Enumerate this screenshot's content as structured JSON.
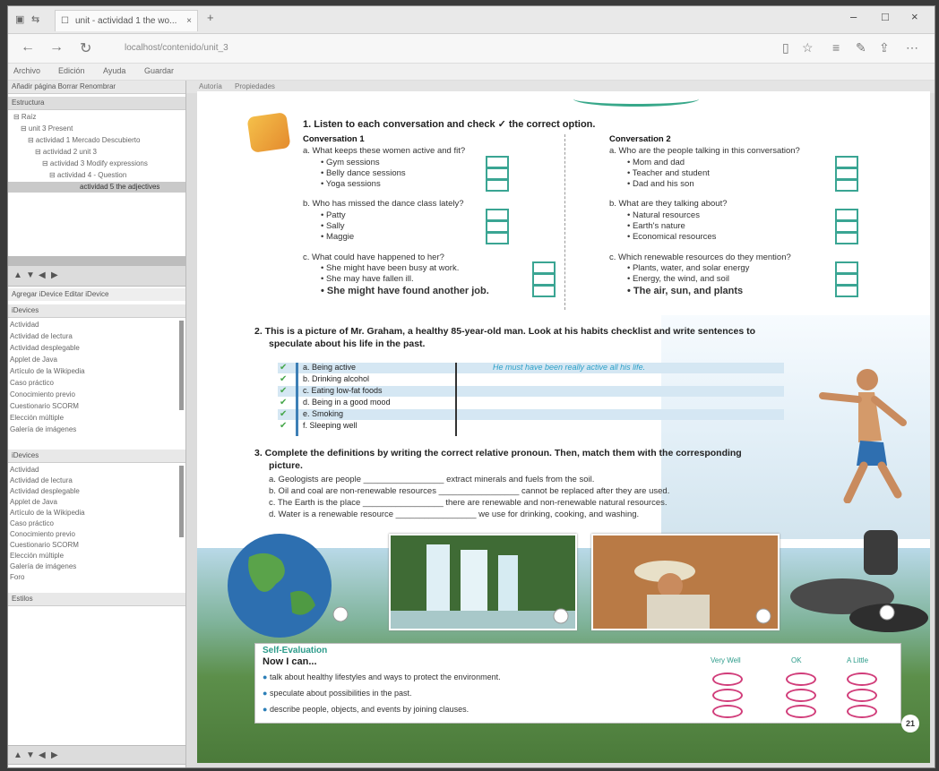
{
  "browser": {
    "tab_title": "unit - actividad 1 the wo...",
    "tab_close": "×",
    "new_tab": "+",
    "url": "localhost/contenido/unit_3",
    "menu_items": [
      "Archivo",
      "Edición",
      "Ayuda",
      "Guardar"
    ],
    "win_min": "–",
    "win_max": "□",
    "win_close": "×"
  },
  "leftpanel": {
    "top_buttons": "Añadir página   Borrar   Renombrar",
    "section1_title": "Estructura",
    "tree": [
      "⊟ Raíz",
      "⊟ unit 3 Present",
      "⊟ actividad 1 Mercado Descubierto",
      "⊟ actividad 2 unit 3",
      "⊟ actividad 3 Modify expressions",
      "⊟ actividad 4 - Question",
      "actividad 5 the adjectives"
    ],
    "mid_buttons": "Agregar iDevice   Editar iDevice",
    "section2_title": "iDevices",
    "list1": [
      "Actividad",
      "Actividad de lectura",
      "Actividad desplegable",
      "Applet de Java",
      "Artículo de la Wikipedia",
      "Caso práctico",
      "Conocimiento previo",
      "Cuestionario SCORM",
      "Elección múltiple",
      "Galería de imágenes"
    ],
    "section3_title": "iDevices",
    "list2": [
      "Actividad",
      "Actividad de lectura",
      "Actividad desplegable",
      "Applet de Java",
      "Artículo de la Wikipedia",
      "Caso práctico",
      "Conocimiento previo",
      "Cuestionario SCORM",
      "Elección múltiple",
      "Galería de imágenes",
      "Foro"
    ],
    "section4_title": "Estilos"
  },
  "doc": {
    "tab1": "Autoría",
    "tab2": "Propiedades",
    "q1_title": "1.  Listen to each conversation and check ✓ the correct option.",
    "conv1_title": "Conversation 1",
    "conv1_a_q": "a.  What keeps these women active and fit?",
    "conv1_a_opts": [
      "•  Gym sessions",
      "•  Belly dance sessions",
      "•  Yoga sessions"
    ],
    "conv1_b_q": "b.  Who has missed the dance class lately?",
    "conv1_b_opts": [
      "•  Patty",
      "•  Sally",
      "•  Maggie"
    ],
    "conv1_c_q": "c.  What could have happened to her?",
    "conv1_c_opts": [
      "•  She might have been busy at work.",
      "•  She may have fallen ill.",
      "•  She might have found another job."
    ],
    "conv2_title": "Conversation 2",
    "conv2_a_q": "a.  Who are the people talking in this conversation?",
    "conv2_a_opts": [
      "•  Mom and dad",
      "•  Teacher and student",
      "•  Dad and his son"
    ],
    "conv2_b_q": "b.  What are they talking about?",
    "conv2_b_opts": [
      "•  Natural resources",
      "•  Earth's nature",
      "•  Economical resources"
    ],
    "conv2_c_q": "c.  Which renewable resources do they mention?",
    "conv2_c_opts": [
      "•  Plants, water, and solar energy",
      "•  Energy, the wind, and soil",
      "•  The air, sun, and plants"
    ],
    "q2_title": "2.  This is a picture of Mr. Graham, a healthy 85-year-old man. Look at his habits checklist and write sentences to",
    "q2_title2": "speculate about his life in the past.",
    "q2_rows": [
      "a.  Being active",
      "b.  Drinking alcohol",
      "c.  Eating low-fat foods",
      "d.  Being in a good mood",
      "e.  Smoking",
      "f.  Sleeping well"
    ],
    "q2_example": "He must have been really active all his life.",
    "q3_title": "3.  Complete the definitions by writing the correct relative pronoun. Then, match them with the corresponding",
    "q3_title2": "picture.",
    "q3_items": [
      "a.  Geologists are people _________________ extract minerals and fuels from the soil.",
      "b.  Oil and coal are non-renewable resources _________________ cannot be replaced after they are used.",
      "c.  The Earth is the place _________________ there are renewable and non-renewable natural resources.",
      "d.  Water is a renewable resource _________________ we use for drinking, cooking, and washing."
    ],
    "self_eval_title": "Self-Evaluation",
    "now_i_can": "Now I can...",
    "col_very_well": "Very Well",
    "col_ok": "OK",
    "col_a_little": "A Little",
    "self_items": [
      "talk about healthy lifestyles and ways to protect the environment.",
      "speculate about possibilities in the past.",
      "describe people, objects, and events by joining clauses."
    ],
    "page_number": "21"
  },
  "colors": {
    "accent": "#3aa593",
    "oval": "#d13d7a",
    "highlight": "#d5e7f3"
  }
}
